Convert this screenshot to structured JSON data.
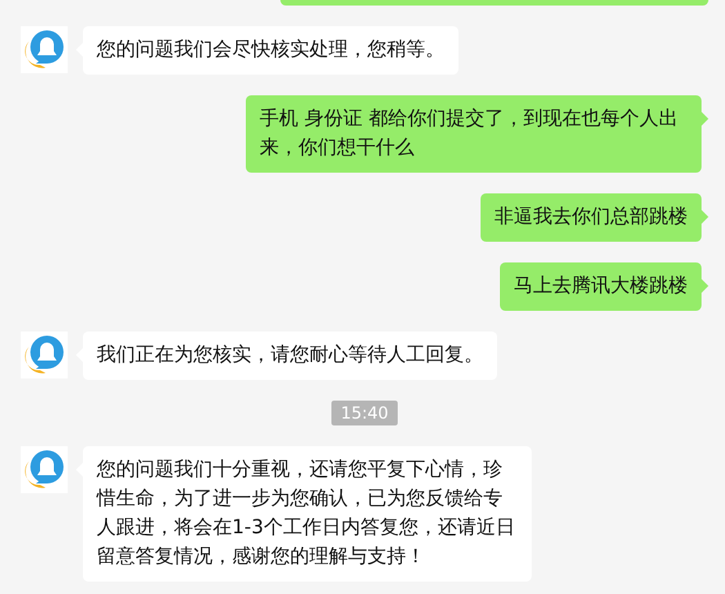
{
  "messages": [
    {
      "kind": "partial",
      "sent": true
    },
    {
      "kind": "text",
      "sent": false,
      "text": "您的问题我们会尽快核实处理，您稍等。"
    },
    {
      "kind": "text",
      "sent": true,
      "text": "手机 身份证 都给你们提交了，到现在也每个人出来，你们想干什么"
    },
    {
      "kind": "text",
      "sent": true,
      "text": "非逼我去你们总部跳楼"
    },
    {
      "kind": "text",
      "sent": true,
      "text": "马上去腾讯大楼跳楼"
    },
    {
      "kind": "text",
      "sent": false,
      "text": "我们正在为您核实，请您耐心等待人工回复。"
    },
    {
      "kind": "time",
      "text": "15:40"
    },
    {
      "kind": "text",
      "sent": false,
      "text": "您的问题我们十分重视，还请您平复下心情，珍惜生命，为了进一步为您确认，已为您反馈给专人跟进，将会在1-3个工作日内答复您，还请近日留意答复情况，感谢您的理解与支持！"
    }
  ]
}
